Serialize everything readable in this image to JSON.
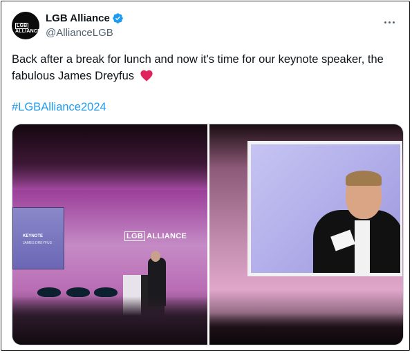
{
  "author": {
    "display_name": "LGB Alliance",
    "handle": "@AllianceLGB",
    "avatar_text": "LGB ALLIANCE"
  },
  "tweet": {
    "text": "Back after a break for lunch and now it's time for our keynote speaker, the fabulous James Dreyfus",
    "hashtag": "#LGBAlliance2024"
  },
  "media": {
    "left_photo": {
      "wall_logo": "LGB ALLIANCE",
      "side_screen_title": "KEYNOTE",
      "side_screen_subtitle": "JAMES DREYFUS"
    }
  },
  "colors": {
    "link": "#1d9bf0",
    "verified": "#1d9bf0",
    "secondary_text": "#536471",
    "heart": "#e0245e"
  },
  "icons": {
    "verified": "verified-badge-icon",
    "more": "more-options-icon",
    "heart": "red-heart-emoji"
  }
}
